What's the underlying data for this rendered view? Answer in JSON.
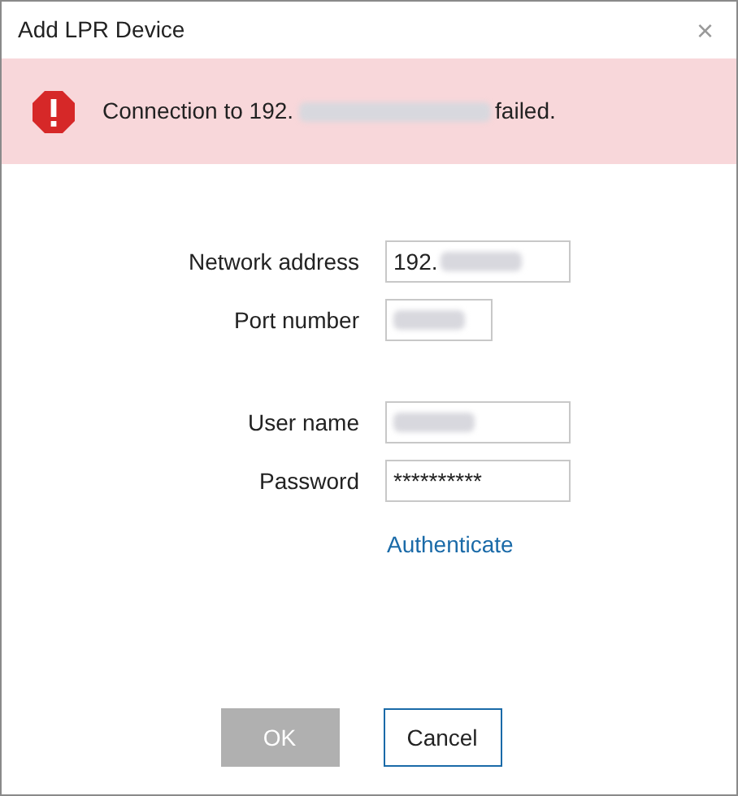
{
  "window": {
    "title": "Add LPR Device",
    "close": "×"
  },
  "error": {
    "text_before": "Connection to 192.",
    "redacted": true,
    "text_after": "failed."
  },
  "fields": [
    {
      "label": "Network address",
      "value": "192.",
      "redacted": true
    },
    {
      "label": "Port number",
      "redacted": true
    },
    {
      "label": "User name",
      "redacted": true
    },
    {
      "label": "Password",
      "value": "**********"
    }
  ],
  "link": "Authenticate",
  "buttons": [
    {
      "label": "OK",
      "disabled": true
    },
    {
      "label": "Cancel",
      "disabled": false
    }
  ]
}
